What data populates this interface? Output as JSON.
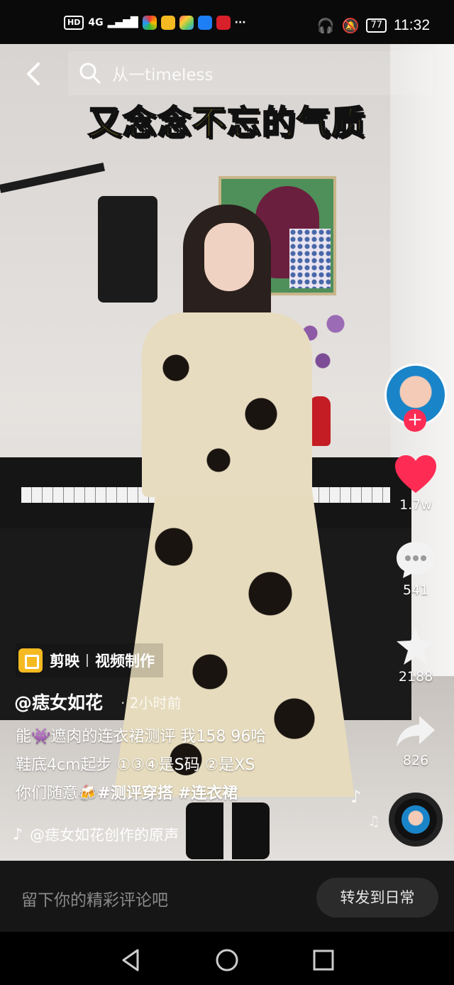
{
  "status_bar": {
    "left_badges": [
      "HD",
      "4G"
    ],
    "battery": "77",
    "time": "11:32"
  },
  "search": {
    "placeholder": "从一timeless"
  },
  "video": {
    "headline": "又念念不忘的气质"
  },
  "right_rail": {
    "likes": "1.7w",
    "comments": "541",
    "favorites": "2188",
    "shares": "826"
  },
  "capcut": {
    "brand": "剪映",
    "label": "视频制作"
  },
  "post": {
    "author": "@痣女如花",
    "time": "· 2小时前",
    "line1": "能👾遮肉的连衣裙测评 我158 96哈",
    "line2": "鞋底4cm起步 ①③④是S码 ②是XS",
    "line3_prefix": "你们随意🍻",
    "tags": [
      "#测评穿搭",
      "#连衣裙"
    ],
    "sound": "@痣女如花创作的原声"
  },
  "comment_bar": {
    "placeholder": "留下你的精彩评论吧",
    "repost": "转发到日常"
  },
  "icons": {
    "back": "back-arrow-icon",
    "search": "search-icon",
    "like": "heart-icon",
    "comment": "comment-icon",
    "favorite": "star-icon",
    "share": "share-icon"
  },
  "colors": {
    "like": "#fe2c55",
    "headline": "#f9ea2c",
    "capcut": "#f5b921"
  }
}
